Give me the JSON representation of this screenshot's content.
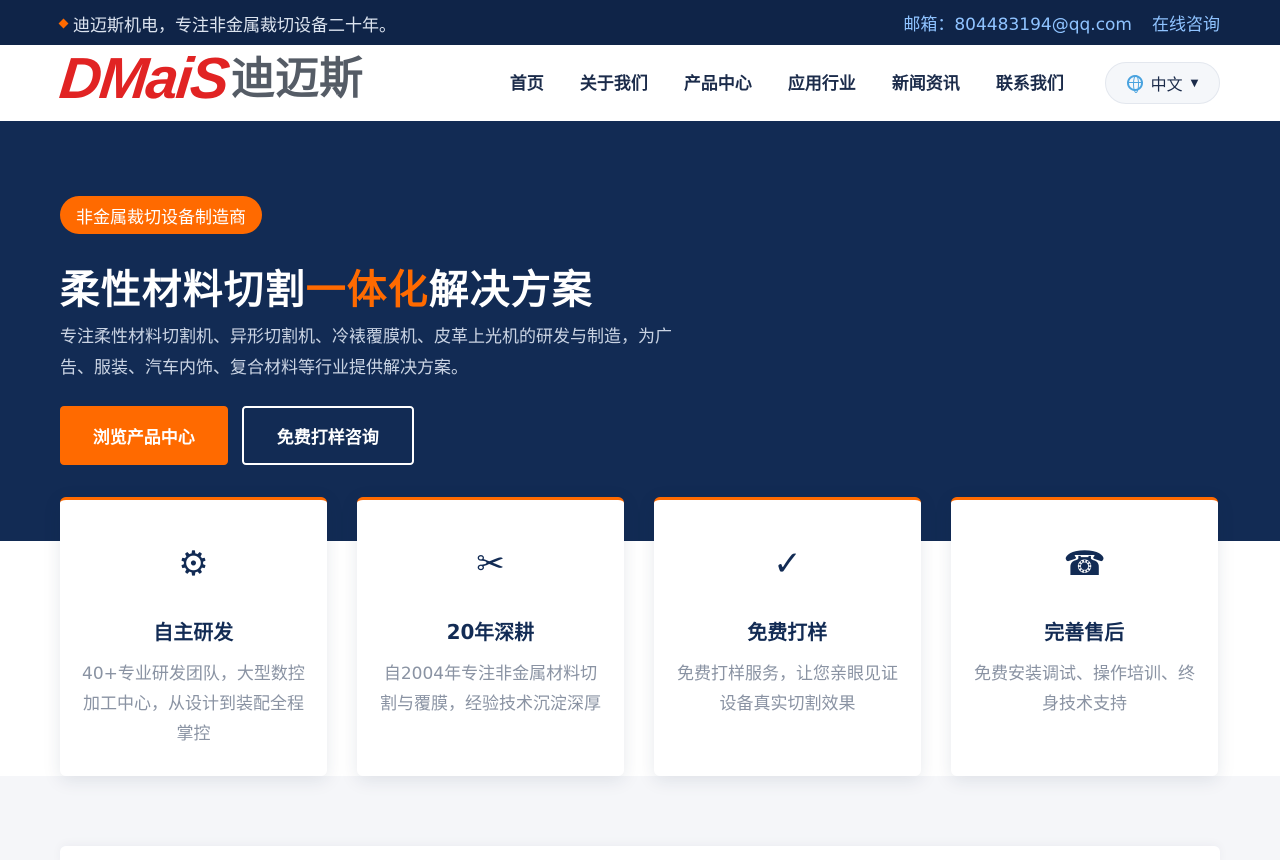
{
  "topbar": {
    "slogan": "迪迈斯机电，专注非金属裁切设备二十年。",
    "email_label": "邮箱：",
    "email_value": "804483194@qq.com",
    "consult_link": "在线咨询"
  },
  "header": {
    "logo_latin": "DMaiS",
    "logo_cn": "迪迈斯",
    "nav": [
      "首页",
      "关于我们",
      "产品中心",
      "应用行业",
      "新闻资讯",
      "联系我们"
    ],
    "language": "中文"
  },
  "hero": {
    "tag": "非金属裁切设备制造商",
    "headline_pre": "柔性材料切割",
    "headline_accent": "一体化",
    "headline_post": "解决方案",
    "subtitle": "专注柔性材料切割机、异形切割机、冷裱覆膜机、皮革上光机的研发与制造，为广告、服装、汽车内饰、复合材料等行业提供解决方案。",
    "primary_button": "浏览产品中心",
    "secondary_button": "免费打样咨询"
  },
  "features": [
    {
      "icon": "gear-icon",
      "glyph": "⚙",
      "title": "自主研发",
      "desc": "40+专业研发团队，大型数控加工中心，从设计到装配全程掌控"
    },
    {
      "icon": "scissors-icon",
      "glyph": "✂",
      "title": "20年深耕",
      "desc": "自2004年专注非金属材料切割与覆膜，经验技术沉淀深厚"
    },
    {
      "icon": "check-icon",
      "glyph": "✓",
      "title": "免费打样",
      "desc": "免费打样服务，让您亲眼见证设备真实切割效果"
    },
    {
      "icon": "phone-icon",
      "glyph": "☎",
      "title": "完善售后",
      "desc": "免费安装调试、操作培训、终身技术支持"
    }
  ],
  "colors": {
    "navy": "#122b54",
    "accent": "#ff6a00",
    "logo_red": "#e12323"
  }
}
